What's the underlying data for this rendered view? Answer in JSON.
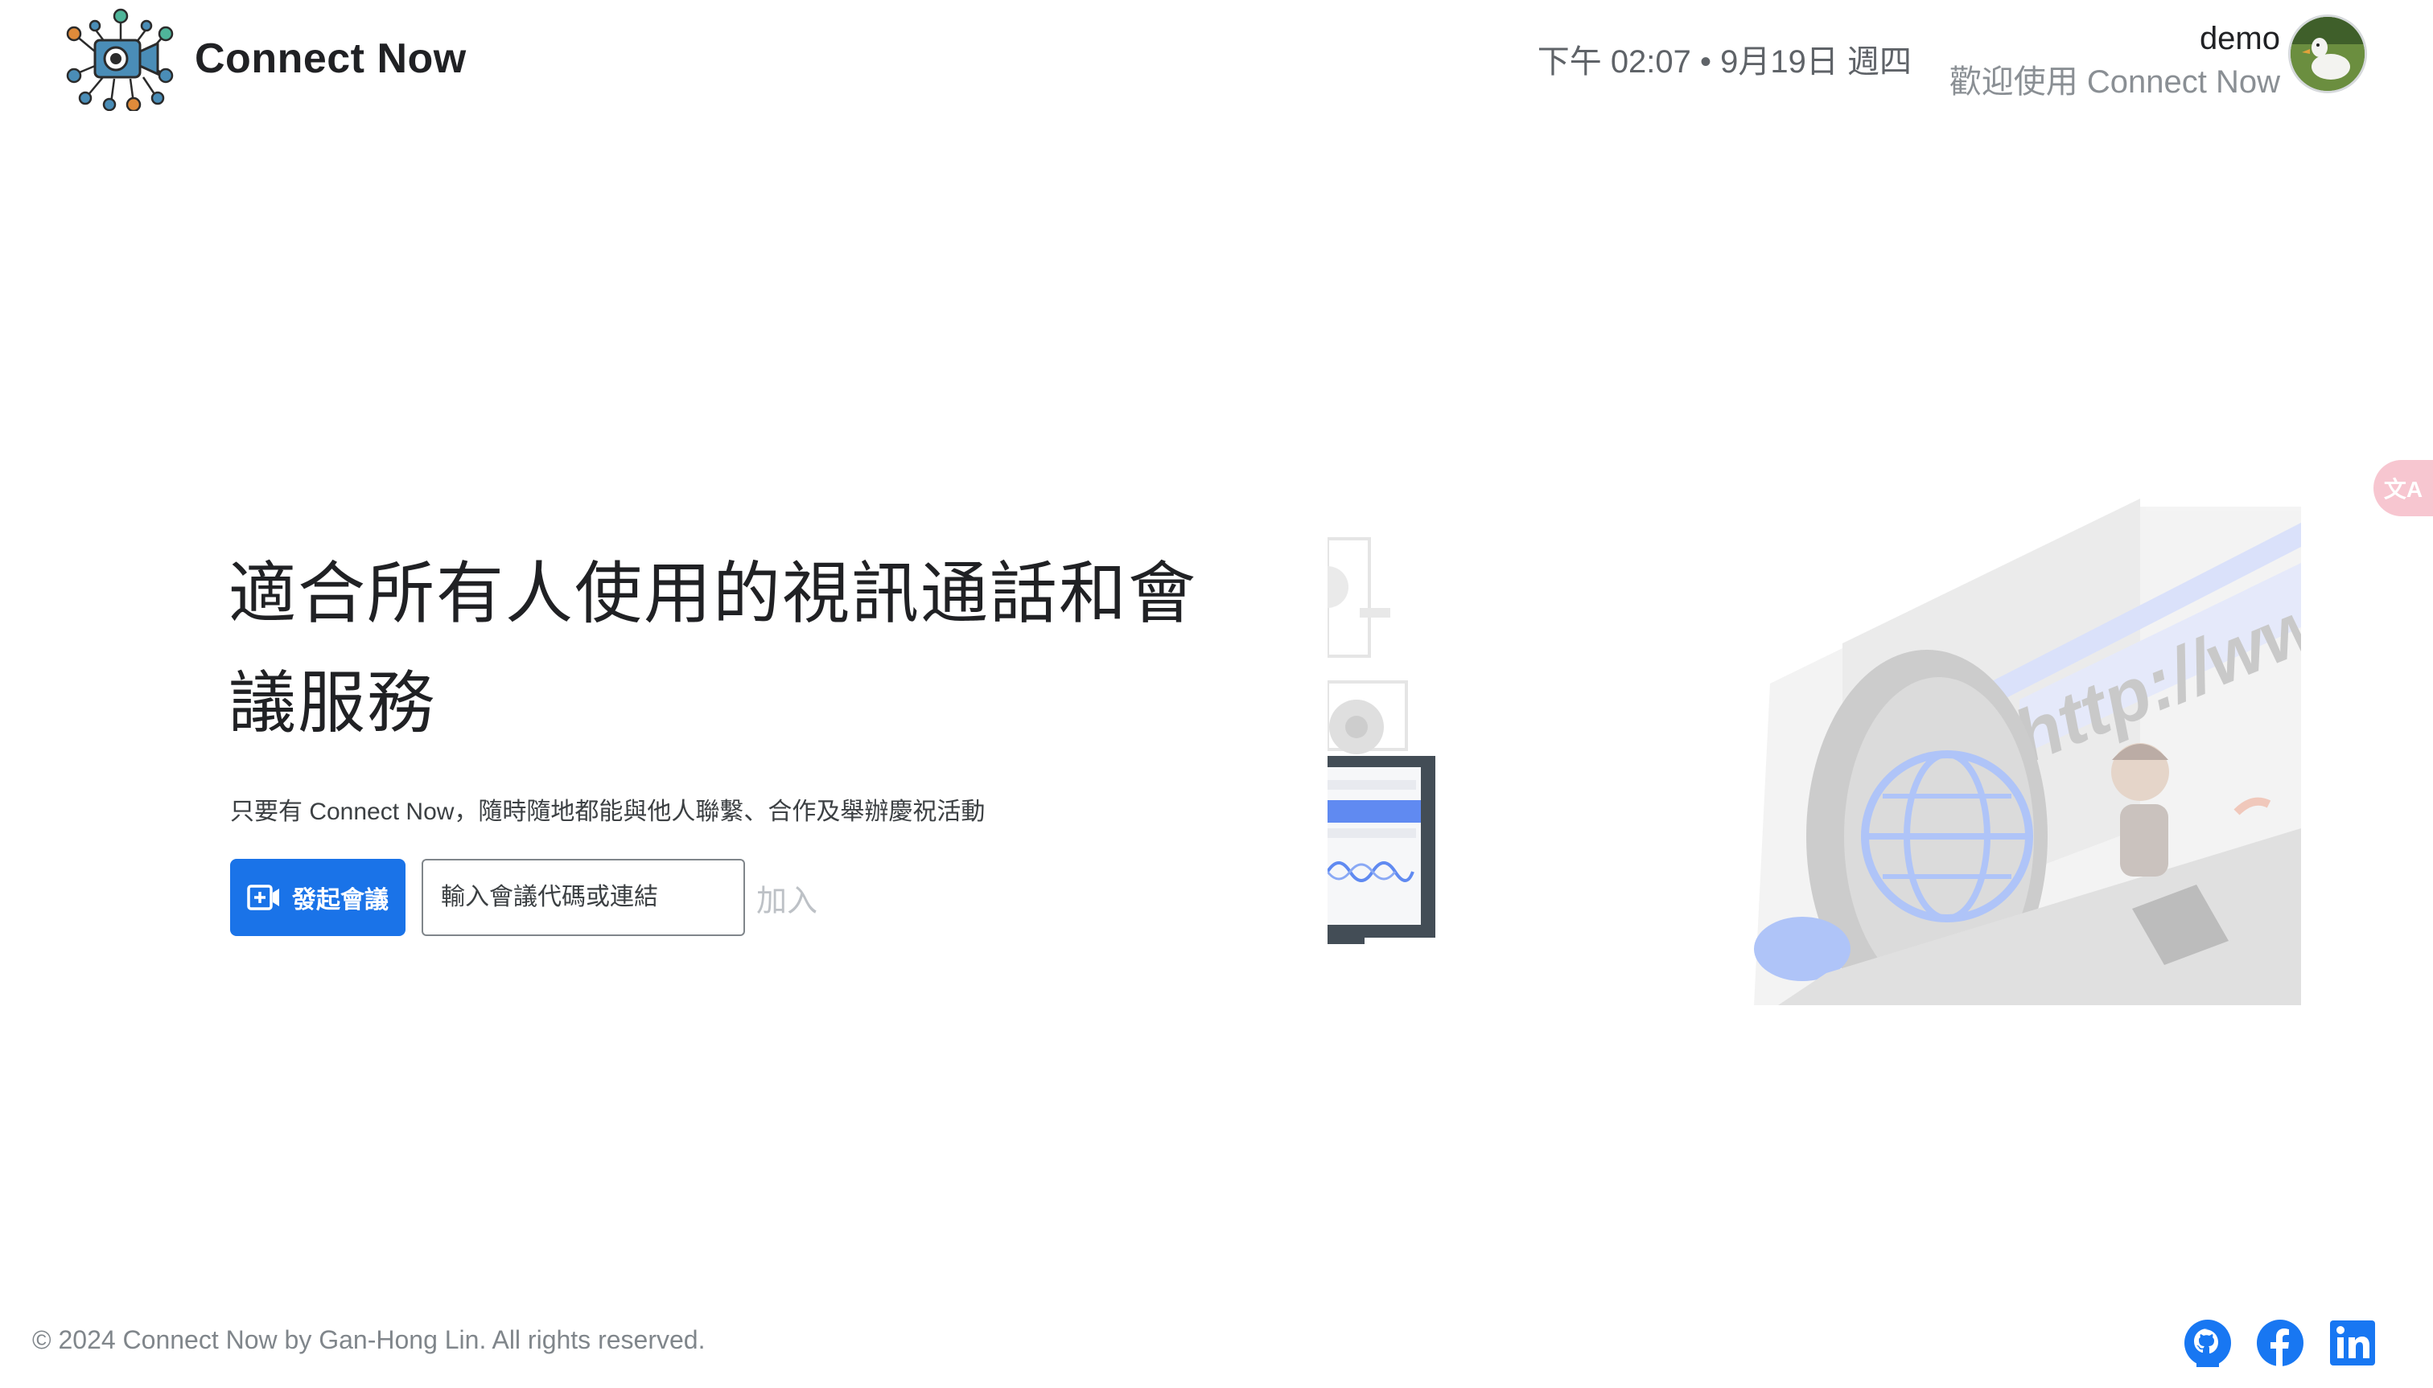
{
  "brand": {
    "name": "Connect Now",
    "logo_icon": "video-camera-network-icon"
  },
  "header": {
    "clock": "下午 02:07 • 9月19日 週四",
    "user_name": "demo",
    "welcome": "歡迎使用 Connect Now",
    "avatar_icon": "duck-avatar"
  },
  "translate_tab": {
    "label": "文A",
    "icon": "translate-icon",
    "color": "#f7c6d0"
  },
  "hero": {
    "title": "適合所有人使用的視訊通話和會議服務",
    "subtitle": "只要有 Connect Now，隨時隨地都能與他人聯繫、合作及舉辦慶祝活動",
    "new_meeting_label": "發起會議",
    "new_meeting_icon": "video-plus-icon",
    "code_placeholder": "輸入會議代碼或連結",
    "code_value": "",
    "join_label": "加入"
  },
  "illustration": {
    "url_text": "http://www"
  },
  "footer": {
    "copyright": "© 2024 Connect Now by Gan-Hong Lin. All rights reserved.",
    "socials": [
      "github-icon",
      "facebook-icon",
      "linkedin-icon"
    ]
  },
  "colors": {
    "primary": "#1a73e8",
    "social_blue": "#1877f2",
    "muted_text": "#80868b"
  }
}
